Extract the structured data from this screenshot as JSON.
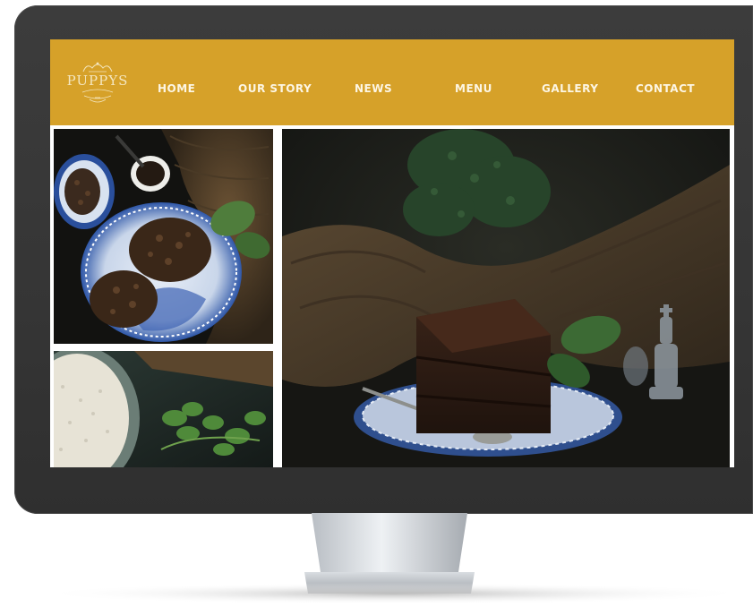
{
  "header": {
    "logo_text": "PUPPYS",
    "logo_color": "#f4e6bf",
    "background_color": "#d6a129"
  },
  "nav": {
    "items": [
      {
        "label": "HOME"
      },
      {
        "label": "OUR STORY"
      },
      {
        "label": "NEWS"
      },
      {
        "label": "MENU"
      },
      {
        "label": "GALLERY"
      },
      {
        "label": "CONTACT"
      }
    ],
    "text_color": "#fdf6e4"
  },
  "gallery": {
    "photos": [
      {
        "subject": "chocolate-cookies-on-blue-plates"
      },
      {
        "subject": "rice-bowl-with-cilantro"
      },
      {
        "subject": "chocolate-cake-slice-with-chess-piece"
      }
    ]
  },
  "device": {
    "bezel_color": "#353535"
  }
}
